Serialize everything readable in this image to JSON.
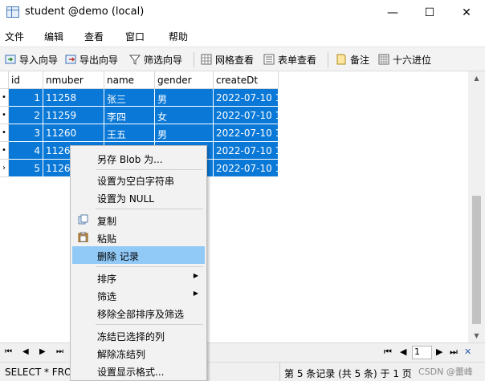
{
  "window": {
    "title": "student @demo (local)",
    "minimize": "—",
    "maximize": "☐",
    "close": "✕"
  },
  "menu": [
    "文件",
    "编辑",
    "查看",
    "窗口",
    "帮助"
  ],
  "toolbar": {
    "import": "导入向导",
    "export": "导出向导",
    "filter": "筛选向导",
    "grid_view": "网格查看",
    "form_view": "表单查看",
    "memo": "备注",
    "hex": "十六进位"
  },
  "table": {
    "columns": [
      "id",
      "nmuber",
      "name",
      "gender",
      "createDt"
    ],
    "rows": [
      {
        "indicator": "•",
        "cells": [
          "1",
          "11258",
          "张三",
          "男",
          "2022-07-10 1"
        ]
      },
      {
        "indicator": "•",
        "cells": [
          "2",
          "11259",
          "李四",
          "女",
          "2022-07-10 1"
        ]
      },
      {
        "indicator": "•",
        "cells": [
          "3",
          "11260",
          "王五",
          "男",
          "2022-07-10 1"
        ]
      },
      {
        "indicator": "•",
        "cells": [
          "4",
          "1126",
          "",
          "",
          "2022-07-10 1"
        ]
      },
      {
        "indicator": "›",
        "cells": [
          "5",
          "1126",
          "",
          "",
          "2022-07-10 1"
        ]
      }
    ],
    "selection_color": "#0a78d7"
  },
  "context_menu": {
    "save_blob": "另存 Blob 为...",
    "set_empty": "设置为空白字符串",
    "set_null": "设置为 NULL",
    "copy": "复制",
    "paste": "粘贴",
    "delete_record": "删除 记录",
    "sort": "排序",
    "filter": "筛选",
    "remove_sort_filter": "移除全部排序及筛选",
    "freeze_column": "冻结已选择的列",
    "unfreeze": "解除冻结列",
    "display_format": "设置显示格式...",
    "highlight_color": "#91c9f7"
  },
  "navigation": {
    "first": "⏮",
    "prev": "◀",
    "next": "▶",
    "last": "⏭",
    "page": "1",
    "add": "+",
    "tools": "✓",
    "delete": "✕"
  },
  "status": {
    "sql": "SELECT * FROM",
    "records": "第 5 条记录 (共 5 条) 于 1 页",
    "watermark": "CSDN @蕾峰"
  }
}
